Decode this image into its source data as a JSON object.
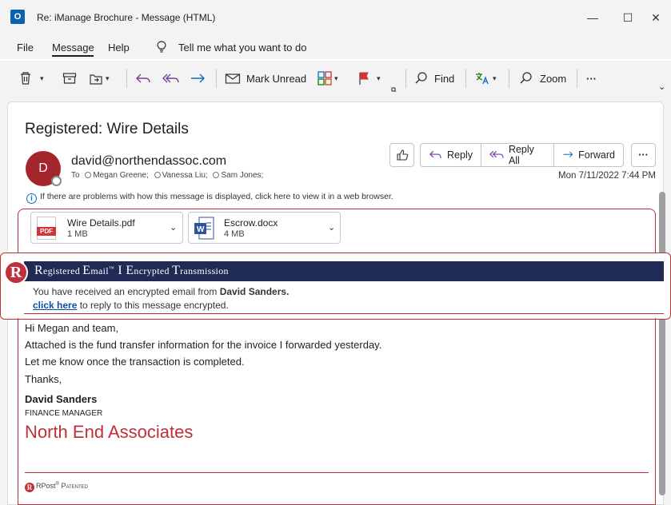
{
  "window": {
    "app_icon": "outlook-icon",
    "title": "Re: iManage Brochure  -  Message (HTML)",
    "minimize": "—",
    "maximize": "☐",
    "close": "✕"
  },
  "menu": {
    "items": [
      "File",
      "Message",
      "Help"
    ],
    "active": "Message",
    "tell_me": "Tell me what you want to do"
  },
  "ribbon": {
    "mark_unread": "Mark Unread",
    "find": "Find",
    "zoom": "Zoom",
    "more": "···"
  },
  "message": {
    "subject": "Registered: Wire Details",
    "avatar_initial": "D",
    "sender": "david@northendassoc.com",
    "to_label": "To",
    "recipients": [
      "Megan Greene;",
      "Vanessa Liu;",
      "Sam Jones;"
    ],
    "info_text": "If there are problems with how this message is displayed, click here to view it in a web browser.",
    "date": "Mon 7/11/2022 7:44 PM",
    "actions": {
      "reply": "Reply",
      "reply_all": "Reply All",
      "forward": "Forward",
      "more": "···"
    }
  },
  "attachments": [
    {
      "name": "Wire Details.pdf",
      "size": "1 MB",
      "type_label": "PDF"
    },
    {
      "name": "Escrow.docx",
      "size": "4 MB",
      "type_label": "W"
    }
  ],
  "encryption_banner": {
    "logo": "R",
    "title_parts": [
      "R",
      "egistered ",
      "E",
      "mail",
      "™",
      " I ",
      "E",
      "ncrypted ",
      "T",
      "ransmission"
    ],
    "line1_prefix": "You have received an encrypted email from ",
    "line1_name": "David Sanders.",
    "link": "click here",
    "line2_suffix": " to reply to this message encrypted."
  },
  "body": {
    "lines": [
      "Hi Megan and team,",
      "Attached is the fund transfer information for the invoice I forwarded yesterday.",
      "Let me know once the transaction is completed.",
      "Thanks,"
    ],
    "signature_name": "David Sanders",
    "signature_role": "FINANCE MANAGER",
    "signature_company": "North End Associates",
    "footer_brand": "RPost",
    "footer_reg": "®",
    "footer_patented": "Patented"
  },
  "colors": {
    "accent_red": "#c0303a",
    "banner_navy": "#1f2a55",
    "avatar": "#a4262c",
    "link": "#0f4f9e"
  }
}
